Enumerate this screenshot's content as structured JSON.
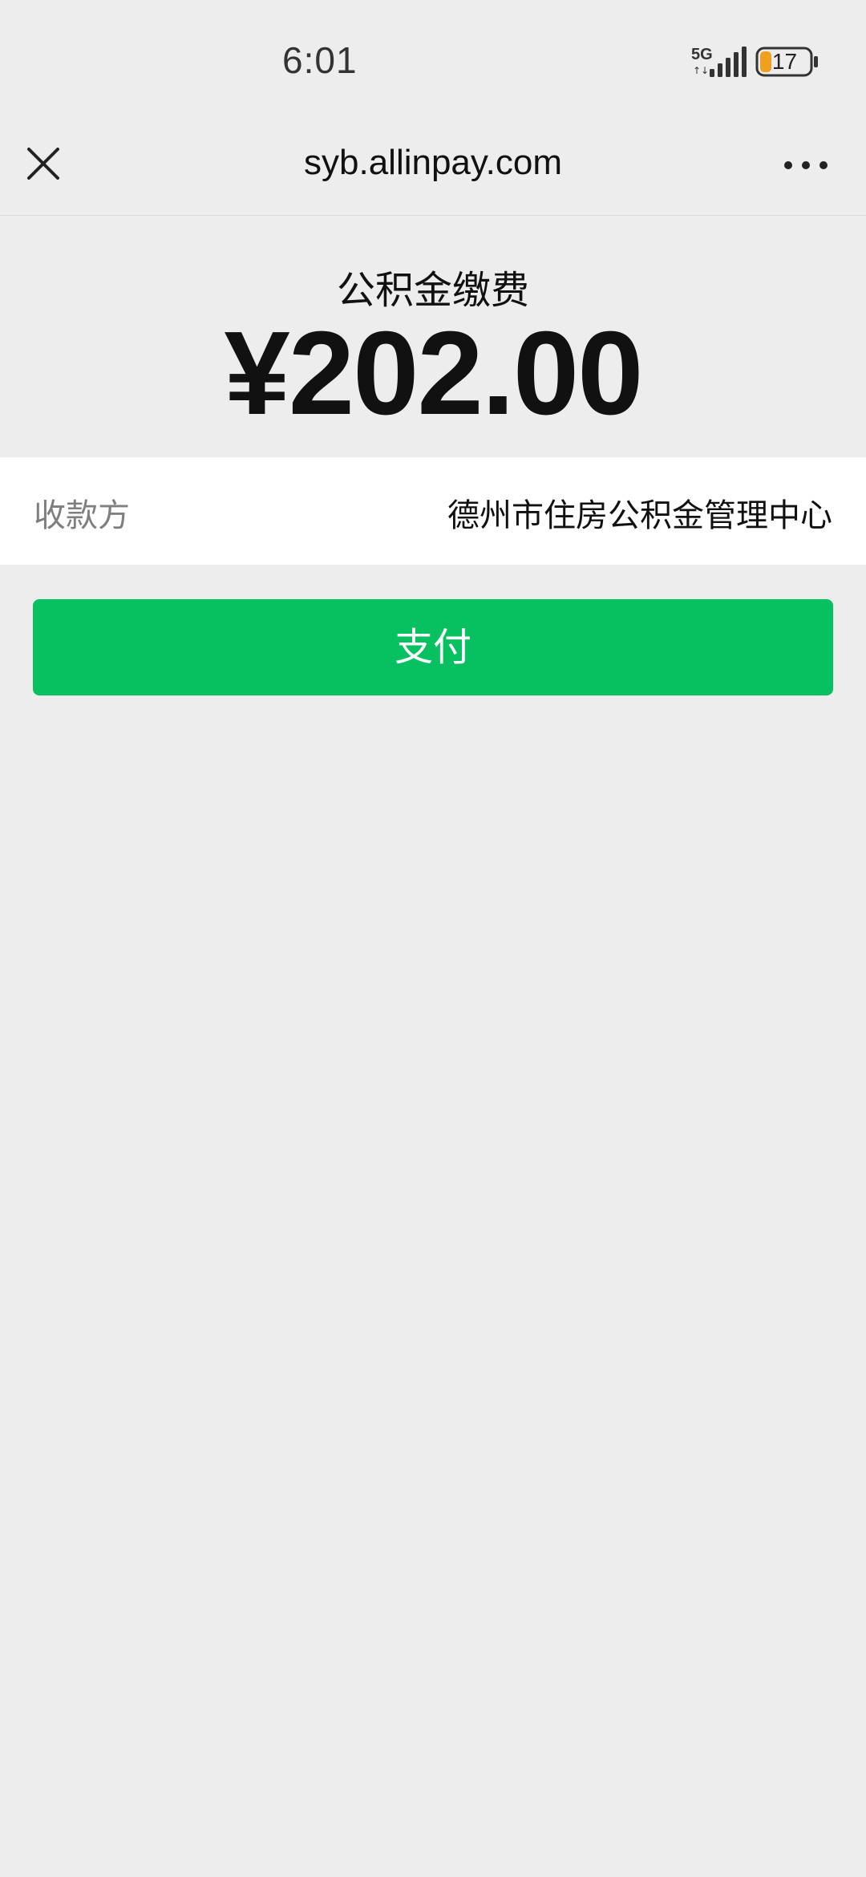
{
  "status_bar": {
    "time": "6:01",
    "network": "5G",
    "network_activity": "↑↓",
    "battery_level": "17",
    "battery_color": "#f0a020"
  },
  "nav": {
    "close_icon": "close-icon",
    "title": "syb.allinpay.com",
    "more_icon": "more-icon"
  },
  "payment": {
    "label": "公积金缴费",
    "amount": "¥202.00",
    "payee_label": "收款方",
    "payee_value": "德州市住房公积金管理中心",
    "pay_button_label": "支付",
    "accent_color": "#07c160"
  }
}
